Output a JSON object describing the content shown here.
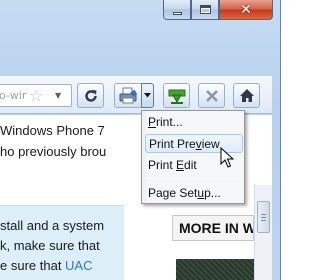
{
  "window": {
    "caption_buttons": {
      "minimize": "minimize-icon",
      "maximize": "maximize-icon",
      "close": "close-icon"
    }
  },
  "toolbar": {
    "address_text": "o-wir",
    "buttons": [
      "refresh-icon",
      "print-icon",
      "dropdown-arrow-icon",
      "download-icon",
      "stop-icon",
      "home-icon"
    ]
  },
  "content": {
    "line1": "Windows Phone 7",
    "line2": "ho previously brou",
    "line3": "stall and a system",
    "line4": "k, make sure that",
    "line5_prefix": "e sure that ",
    "line5_link": "UAC",
    "more_heading": "MORE IN W"
  },
  "print_menu": {
    "items": [
      {
        "label": "Print...",
        "accel": "P"
      },
      {
        "label": "Print Preview",
        "accel": "v",
        "highlighted": true
      },
      {
        "label": "Print Edit",
        "accel": "E"
      },
      {
        "label": "Page Setup...",
        "accel": "u"
      }
    ]
  },
  "colors": {
    "frame": "#bcd4ee",
    "close_button": "#c43b1c",
    "menu_highlight": "#dceafa",
    "link": "#2a7ac0",
    "content_box": "#dceef8"
  }
}
